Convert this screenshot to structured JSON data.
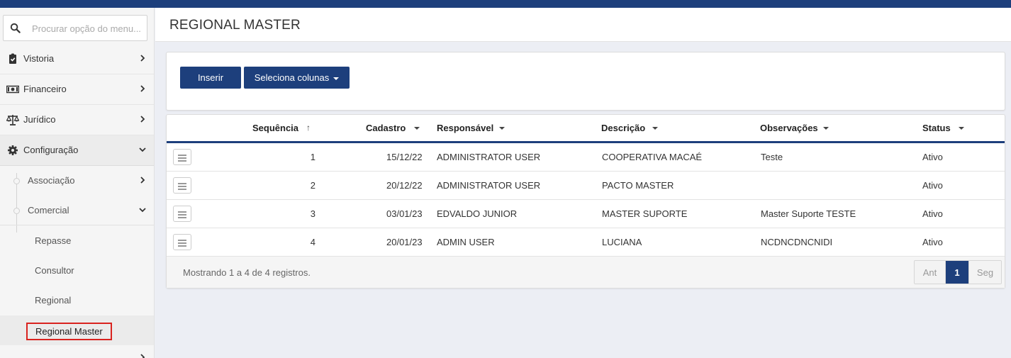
{
  "colors": {
    "brand": "#1d3f7c",
    "highlight_border": "#d9231f"
  },
  "search": {
    "placeholder": "Procurar opção do menu..."
  },
  "sidebar": {
    "items": [
      {
        "label": "Vistoria",
        "icon": "clipboard-check-icon"
      },
      {
        "label": "Financeiro",
        "icon": "money-bill-icon"
      },
      {
        "label": "Jurídico",
        "icon": "balance-scale-icon"
      },
      {
        "label": "Configuração",
        "icon": "gear-icon"
      }
    ],
    "config_children": [
      {
        "label": "Associação"
      },
      {
        "label": "Comercial"
      }
    ],
    "comercial_children": [
      {
        "label": "Repasse"
      },
      {
        "label": "Consultor"
      },
      {
        "label": "Regional"
      },
      {
        "label": "Regional Master"
      }
    ]
  },
  "header": {
    "title": "REGIONAL MASTER"
  },
  "toolbar": {
    "insert_label": "Inserir",
    "columns_label": "Seleciona colunas"
  },
  "table": {
    "columns": [
      "Sequência",
      "Cadastro",
      "Responsável",
      "Descrição",
      "Observações",
      "Status"
    ],
    "rows": [
      {
        "seq": "1",
        "cadastro": "15/12/22",
        "responsavel": "ADMINISTRATOR USER",
        "descricao": "COOPERATIVA MACAÉ",
        "observacoes": "Teste",
        "status": "Ativo"
      },
      {
        "seq": "2",
        "cadastro": "20/12/22",
        "responsavel": "ADMINISTRATOR USER",
        "descricao": "PACTO MASTER",
        "observacoes": "",
        "status": "Ativo"
      },
      {
        "seq": "3",
        "cadastro": "03/01/23",
        "responsavel": "EDVALDO JUNIOR",
        "descricao": "MASTER SUPORTE",
        "observacoes": "Master Suporte TESTE",
        "status": "Ativo"
      },
      {
        "seq": "4",
        "cadastro": "20/01/23",
        "responsavel": "ADMIN USER",
        "descricao": "LUCIANA",
        "observacoes": "NCDNCDNCNIDI",
        "status": "Ativo"
      }
    ],
    "footer_info": "Mostrando 1 a 4 de 4 registros."
  },
  "pagination": {
    "prev": "Ant",
    "current": "1",
    "next": "Seg"
  }
}
